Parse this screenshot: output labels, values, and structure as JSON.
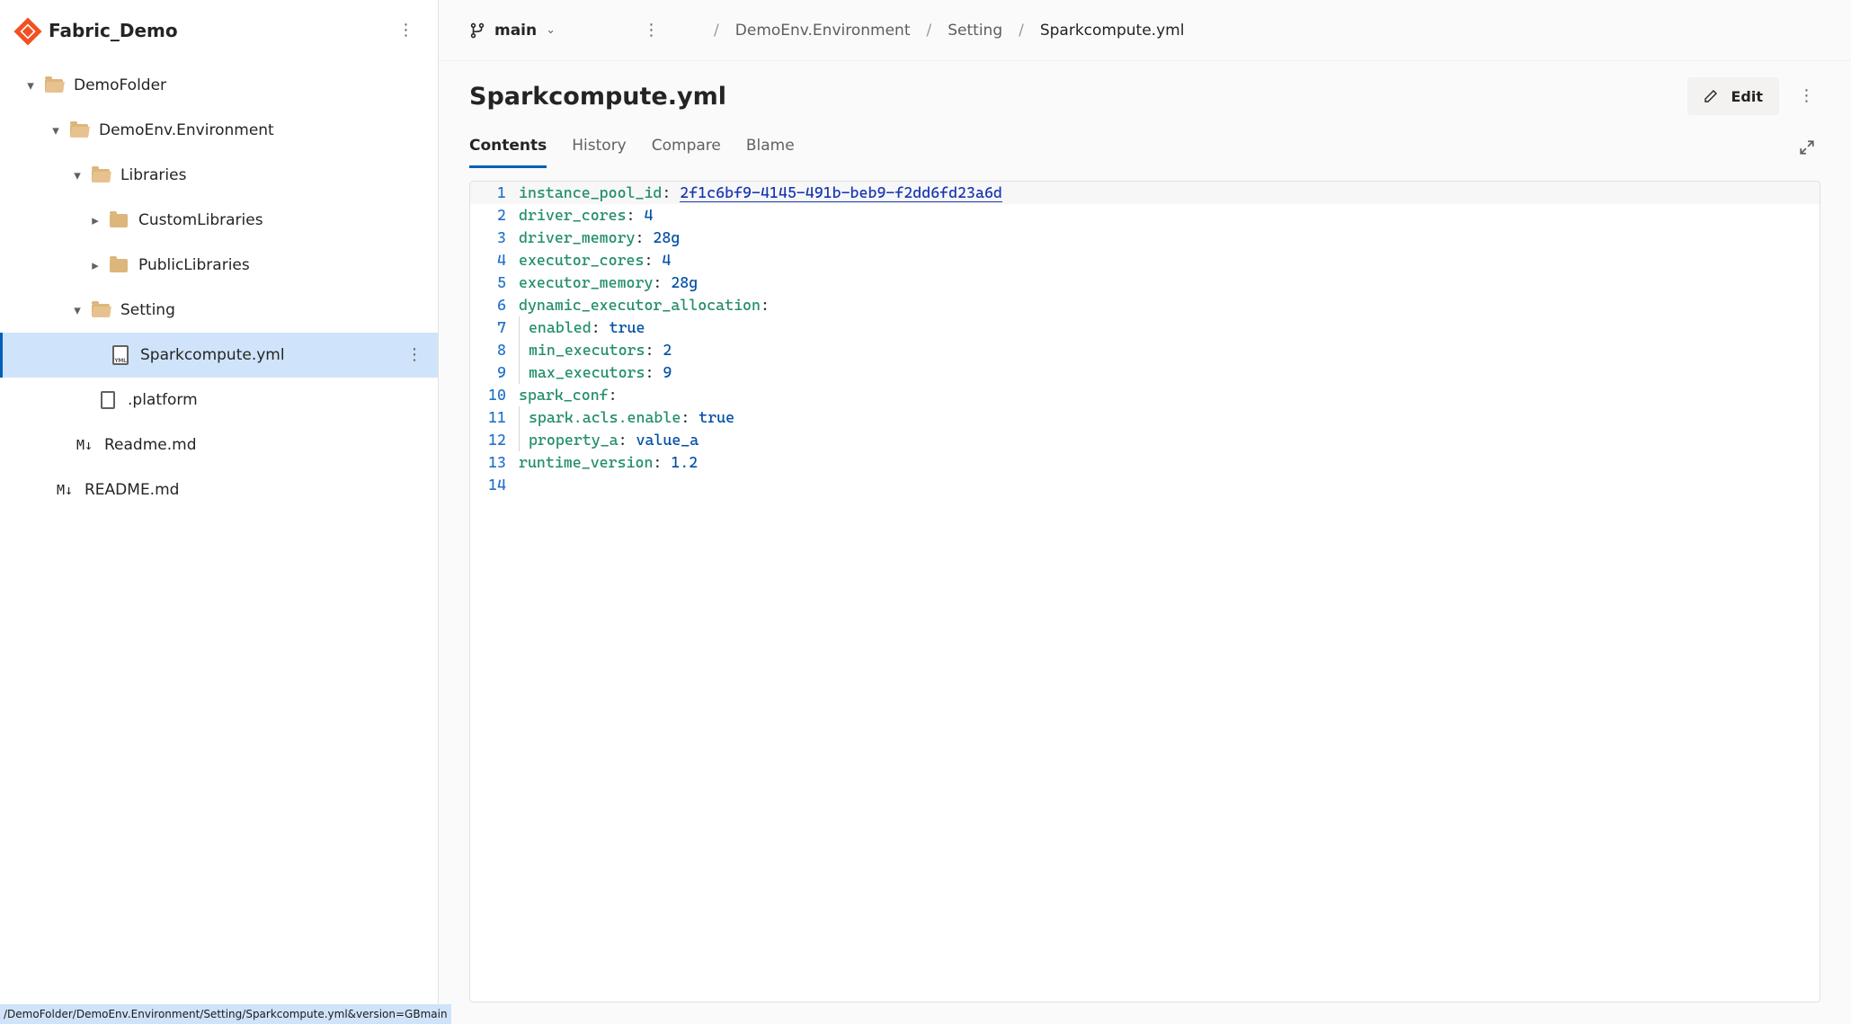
{
  "sidebar": {
    "repo_name": "Fabric_Demo",
    "status_url": "/DemoFolder/DemoEnv.Environment/Setting/Sparkcompute.yml&version=GBmain",
    "tree": {
      "root_label": "DemoFolder",
      "env_label": "DemoEnv.Environment",
      "libraries_label": "Libraries",
      "custom_libs_label": "CustomLibraries",
      "public_libs_label": "PublicLibraries",
      "setting_label": "Setting",
      "sparkcompute_label": "Sparkcompute.yml",
      "platform_label": ".platform",
      "readme_inner_label": "Readme.md",
      "readme_outer_label": "README.md"
    }
  },
  "header": {
    "branch": "main",
    "crumbs": [
      "DemoEnv.Environment",
      "Setting",
      "Sparkcompute.yml"
    ]
  },
  "file": {
    "title": "Sparkcompute.yml",
    "edit_label": "Edit",
    "tabs": [
      "Contents",
      "History",
      "Compare",
      "Blame"
    ],
    "active_tab": 0
  },
  "code": {
    "lines": [
      {
        "n": 1,
        "indent": 0,
        "key": "instance_pool_id",
        "valtype": "guid",
        "val": "2f1c6bf9-4145-491b-beb9-f2dd6fd23a6d",
        "hl": true
      },
      {
        "n": 2,
        "indent": 0,
        "key": "driver_cores",
        "valtype": "num",
        "val": "4"
      },
      {
        "n": 3,
        "indent": 0,
        "key": "driver_memory",
        "valtype": "num",
        "val": "28g"
      },
      {
        "n": 4,
        "indent": 0,
        "key": "executor_cores",
        "valtype": "num",
        "val": "4"
      },
      {
        "n": 5,
        "indent": 0,
        "key": "executor_memory",
        "valtype": "num",
        "val": "28g"
      },
      {
        "n": 6,
        "indent": 0,
        "key": "dynamic_executor_allocation",
        "valtype": "none",
        "val": ""
      },
      {
        "n": 7,
        "indent": 1,
        "key": "enabled",
        "valtype": "num",
        "val": "true"
      },
      {
        "n": 8,
        "indent": 1,
        "key": "min_executors",
        "valtype": "num",
        "val": "2"
      },
      {
        "n": 9,
        "indent": 1,
        "key": "max_executors",
        "valtype": "num",
        "val": "9"
      },
      {
        "n": 10,
        "indent": 0,
        "key": "spark_conf",
        "valtype": "none",
        "val": ""
      },
      {
        "n": 11,
        "indent": 1,
        "key": "spark.acls.enable",
        "valtype": "num",
        "val": "true"
      },
      {
        "n": 12,
        "indent": 1,
        "key": "property_a",
        "valtype": "num",
        "val": "value_a"
      },
      {
        "n": 13,
        "indent": 0,
        "key": "runtime_version",
        "valtype": "num",
        "val": "1.2"
      },
      {
        "n": 14,
        "indent": 0,
        "key": "",
        "valtype": "empty",
        "val": ""
      }
    ]
  }
}
